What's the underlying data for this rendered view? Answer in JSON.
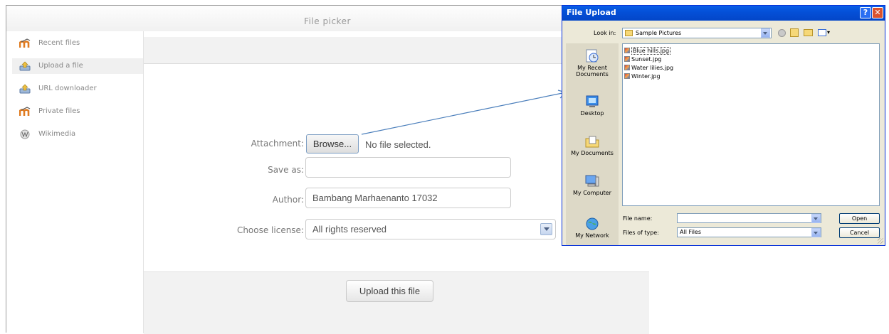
{
  "file_picker": {
    "title": "File picker",
    "sidebar": [
      {
        "label": "Recent files",
        "icon": "moodle-logo-icon"
      },
      {
        "label": "Upload a file",
        "icon": "upload-icon"
      },
      {
        "label": "URL downloader",
        "icon": "url-downloader-icon"
      },
      {
        "label": "Private files",
        "icon": "moodle-logo-icon"
      },
      {
        "label": "Wikimedia",
        "icon": "wikimedia-icon"
      }
    ],
    "form": {
      "attachment_label": "Attachment:",
      "browse_label": "Browse...",
      "no_file_text": "No file selected.",
      "save_as_label": "Save as:",
      "save_as_value": "",
      "author_label": "Author:",
      "author_value": "Bambang Marhaenanto 17032",
      "license_label": "Choose license:",
      "license_value": "All rights reserved"
    },
    "upload_button": "Upload this file"
  },
  "file_upload_dialog": {
    "title": "File Upload",
    "look_in_label": "Look in:",
    "look_in_value": "Sample Pictures",
    "places": [
      {
        "label": "My Recent Documents",
        "icon": "recent-documents-icon"
      },
      {
        "label": "Desktop",
        "icon": "desktop-icon"
      },
      {
        "label": "My Documents",
        "icon": "my-documents-icon"
      },
      {
        "label": "My Computer",
        "icon": "my-computer-icon"
      },
      {
        "label": "My Network",
        "icon": "my-network-icon"
      }
    ],
    "files": [
      "Blue hills.jpg",
      "Sunset.jpg",
      "Water lilies.jpg",
      "Winter.jpg"
    ],
    "file_name_label": "File name:",
    "file_name_value": "",
    "files_of_type_label": "Files of type:",
    "files_of_type_value": "All Files",
    "open_button": "Open",
    "cancel_button": "Cancel"
  },
  "colors": {
    "xp_title": "#0450d8",
    "xp_face": "#ece9d8",
    "arrow": "#4a7ebb"
  }
}
